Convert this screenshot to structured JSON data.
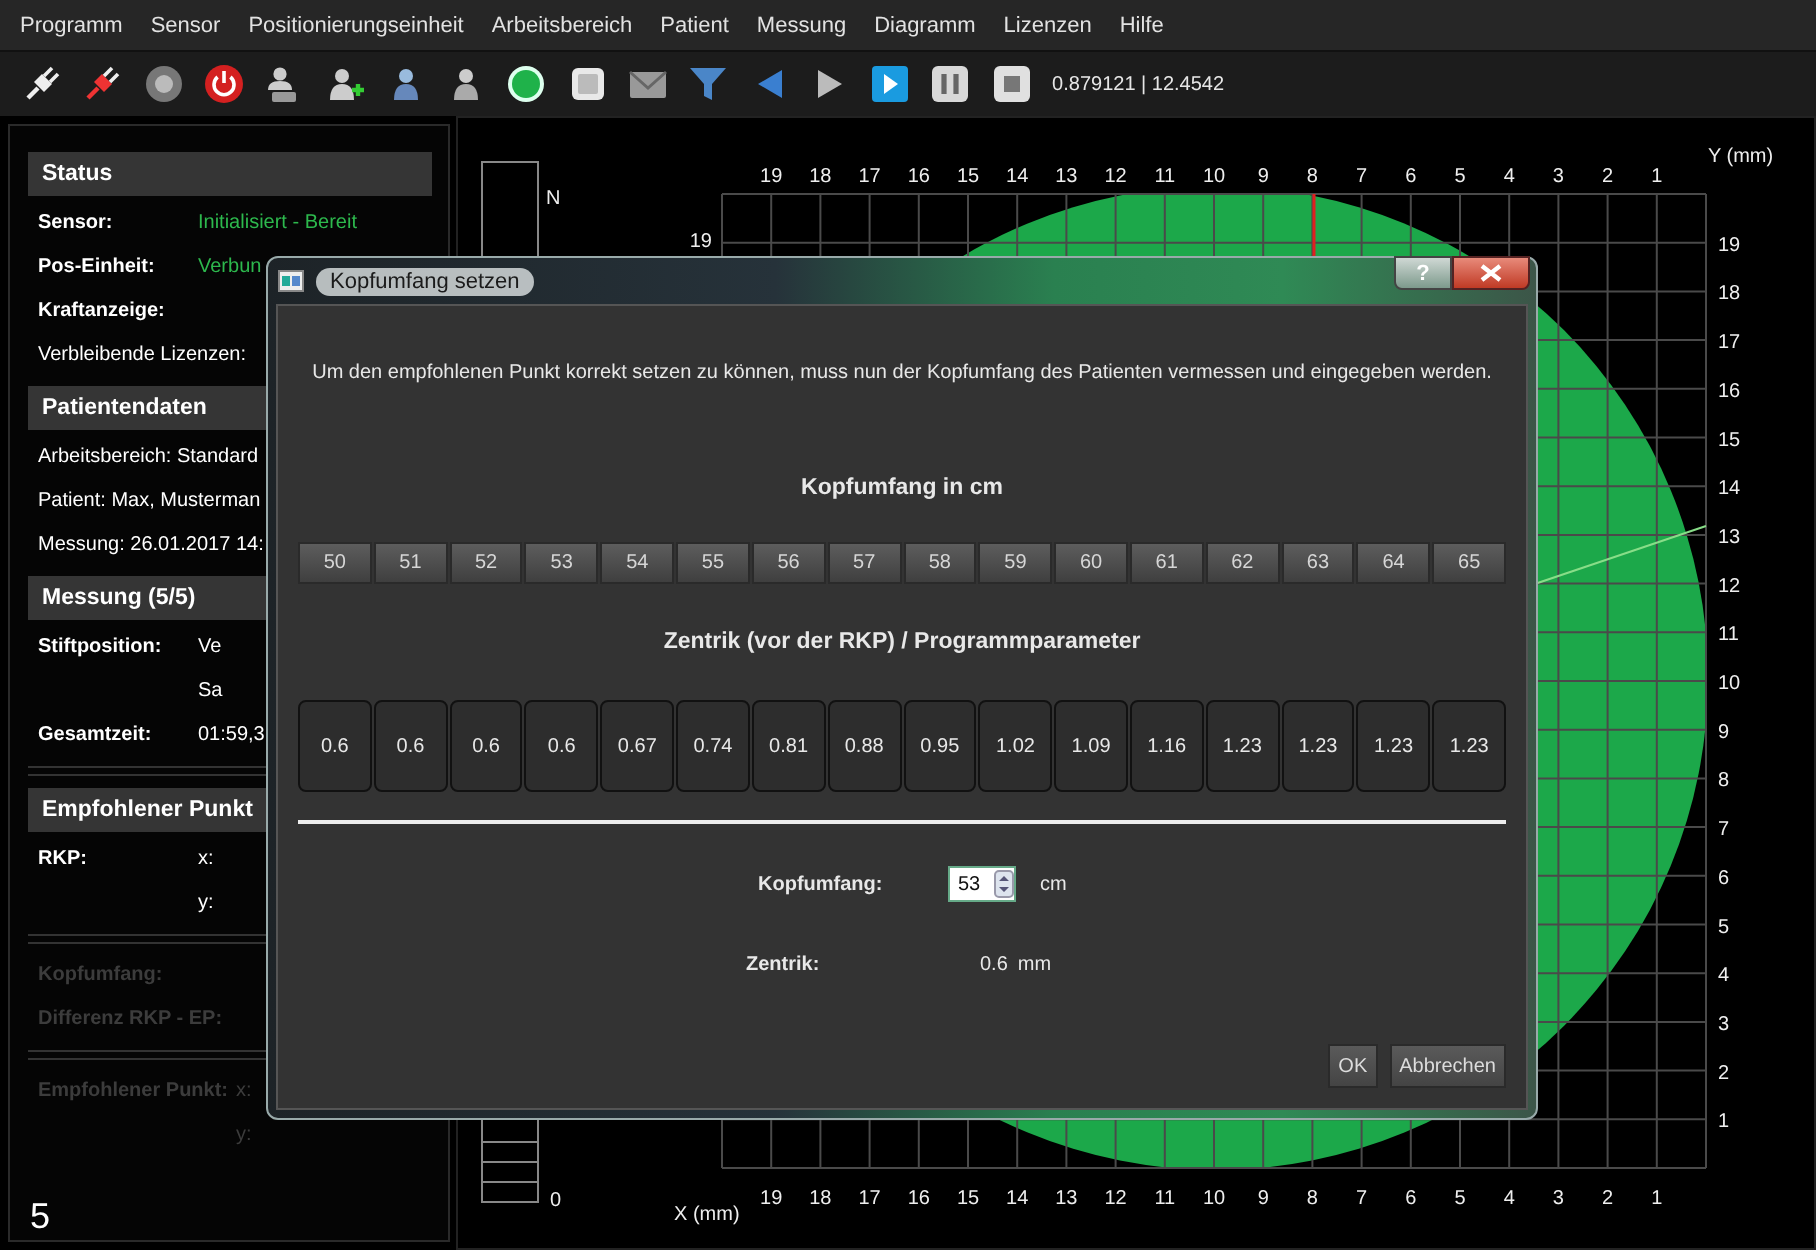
{
  "menu": [
    {
      "label": "Programm"
    },
    {
      "label": "Sensor"
    },
    {
      "label": "Positionierungseinheit"
    },
    {
      "label": "Arbeitsbereich"
    },
    {
      "label": "Patient"
    },
    {
      "label": "Messung"
    },
    {
      "label": "Diagramm"
    },
    {
      "label": "Lizenzen"
    },
    {
      "label": "Hilfe"
    }
  ],
  "toolbar": {
    "buttons": [
      {
        "kind": "plug"
      },
      {
        "kind": "unplug"
      },
      {
        "kind": "disc"
      },
      {
        "kind": "power"
      },
      {
        "kind": "person-flask"
      },
      {
        "kind": "person-add"
      },
      {
        "kind": "person-blue"
      },
      {
        "kind": "person"
      },
      {
        "kind": "record"
      },
      {
        "kind": "square"
      },
      {
        "kind": "envelope"
      },
      {
        "kind": "funnel"
      },
      {
        "kind": "back"
      },
      {
        "kind": "forward"
      },
      {
        "kind": "play"
      },
      {
        "kind": "pause"
      },
      {
        "kind": "stop"
      }
    ],
    "coordinates": "0.879121 | 12.4542"
  },
  "sidebar": {
    "sections": [
      {
        "title": "Status",
        "divider_before": false,
        "rows": [
          {
            "kind": "field",
            "label": "Sensor:",
            "values": [
              "Initialisiert - Bereit"
            ],
            "color": "#2db84d",
            "disabled": false
          },
          {
            "kind": "field",
            "label": "Pos-Einheit:",
            "values": [
              "Verbun"
            ],
            "color": "#2db84d",
            "disabled": false
          },
          {
            "kind": "field",
            "label": "Kraftanzeige:",
            "disabled": false
          },
          {
            "kind": "plain",
            "label": "Verbleibende Lizenzen:",
            "disabled": false
          }
        ]
      },
      {
        "title": "Patientendaten",
        "divider_before": false,
        "rows": [
          {
            "kind": "plain",
            "label": "Arbeitsbereich: Standard",
            "disabled": false
          },
          {
            "kind": "plain",
            "label": "Patient: Max, Musterman",
            "disabled": false
          },
          {
            "kind": "plain",
            "label": "Messung: 26.01.2017 14:",
            "disabled": false
          }
        ]
      },
      {
        "title": "Messung (5/5)",
        "divider_before": false,
        "rows": [
          {
            "kind": "field",
            "label": "Stiftposition:",
            "values": [
              "Ve",
              "Sa"
            ],
            "color": "#ffffff",
            "disabled": false
          },
          {
            "kind": "field",
            "label": "Gesamtzeit:",
            "values": [
              "01:59,3"
            ],
            "color": "#ffffff",
            "disabled": false
          }
        ]
      },
      {
        "title": "Empfohlener Punkt",
        "divider_before": true,
        "rows": [
          {
            "kind": "field",
            "label": "RKP:",
            "values": [
              "x:",
              "y:"
            ],
            "color": "#ffffff",
            "disabled": false
          }
        ]
      },
      {
        "divider_before": true,
        "rows": [
          {
            "kind": "field",
            "label": "Kopfumfang:",
            "disabled": true
          },
          {
            "kind": "field",
            "label": "Differenz RKP - EP:",
            "disabled": true
          }
        ]
      },
      {
        "divider_before": true,
        "rows": [
          {
            "kind": "field",
            "label": "Empfohlener Punkt:",
            "values": [
              "x:",
              "y:"
            ],
            "color": "#3c3c3c",
            "disabled": true
          }
        ]
      }
    ],
    "figure_number": "5"
  },
  "plot": {
    "x_label": "X (mm)",
    "y_label": "Y (mm)",
    "scale_labels": [
      "N",
      "0"
    ],
    "top_ticks": [
      "19",
      "18",
      "17",
      "16",
      "15",
      "14",
      "13",
      "12",
      "11",
      "10",
      "9",
      "8",
      "7",
      "6",
      "5",
      "4",
      "3",
      "2",
      "1"
    ],
    "bottom_ticks": [
      "19",
      "18",
      "17",
      "16",
      "15",
      "14",
      "13",
      "12",
      "11",
      "10",
      "9",
      "8",
      "7",
      "6",
      "5",
      "4",
      "3",
      "2",
      "1"
    ],
    "right_ticks": [
      "19",
      "18",
      "17",
      "16",
      "15",
      "14",
      "13",
      "12",
      "11",
      "10",
      "9",
      "8",
      "7",
      "6",
      "5",
      "4",
      "3",
      "2",
      "1"
    ],
    "left_ticks": [
      "19"
    ]
  },
  "dialog": {
    "title": "Kopfumfang setzen",
    "help": "?",
    "instruction": "Um den empfohlenen Punkt korrekt setzen zu können, muss nun der Kopfumfang des Patienten vermessen und eingegeben werden.",
    "sizes_heading": "Kopfumfang in cm",
    "sizes": [
      "50",
      "51",
      "52",
      "53",
      "54",
      "55",
      "56",
      "57",
      "58",
      "59",
      "60",
      "61",
      "62",
      "63",
      "64",
      "65"
    ],
    "params_heading": "Zentrik (vor der RKP) / Programmparameter",
    "params": [
      "0.6",
      "0.6",
      "0.6",
      "0.6",
      "0.67",
      "0.74",
      "0.81",
      "0.88",
      "0.95",
      "1.02",
      "1.09",
      "1.16",
      "1.23",
      "1.23",
      "1.23",
      "1.23"
    ],
    "circumference": {
      "label": "Kopfumfang:",
      "value": "53",
      "unit": "cm"
    },
    "centric": {
      "label": "Zentrik:",
      "value": "0.6",
      "unit": "mm"
    },
    "buttons": [
      "OK",
      "Abbrechen"
    ]
  }
}
